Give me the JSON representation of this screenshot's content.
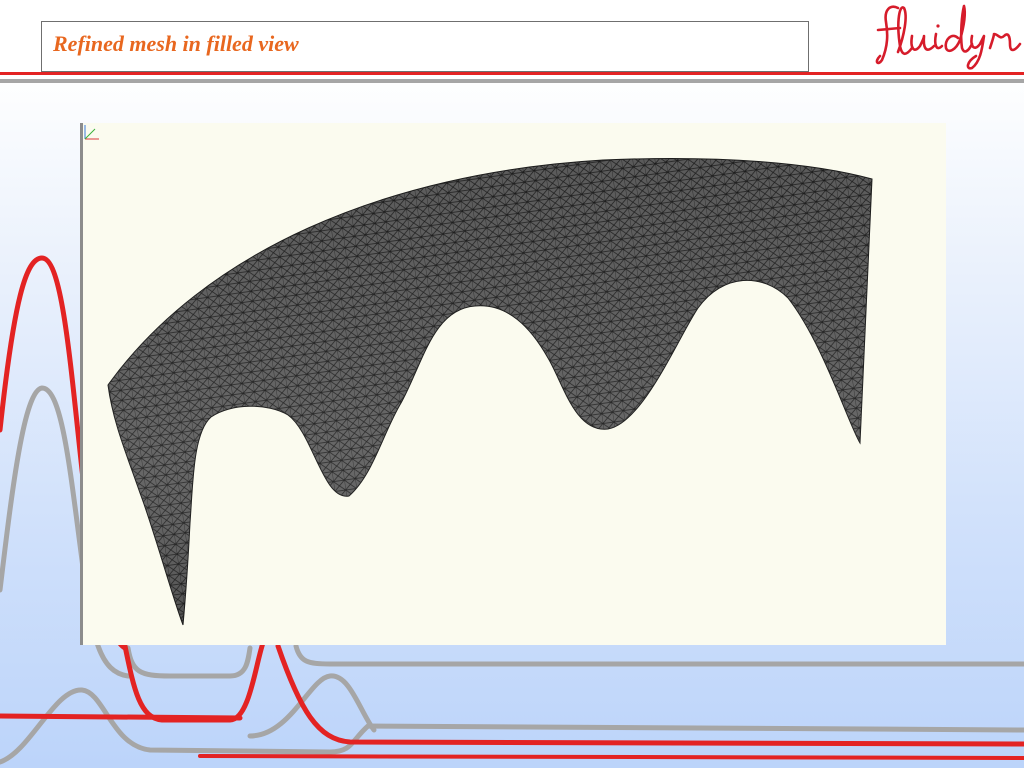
{
  "slide": {
    "title": "Refined mesh in filled view"
  },
  "brand": {
    "logo_text": "fluidyn",
    "accent_color": "#e32323",
    "title_color": "#e8671f"
  },
  "viewport": {
    "background": "#fbfbef",
    "mesh_fill": "#606060",
    "mesh_line": "#1e1e1e"
  }
}
